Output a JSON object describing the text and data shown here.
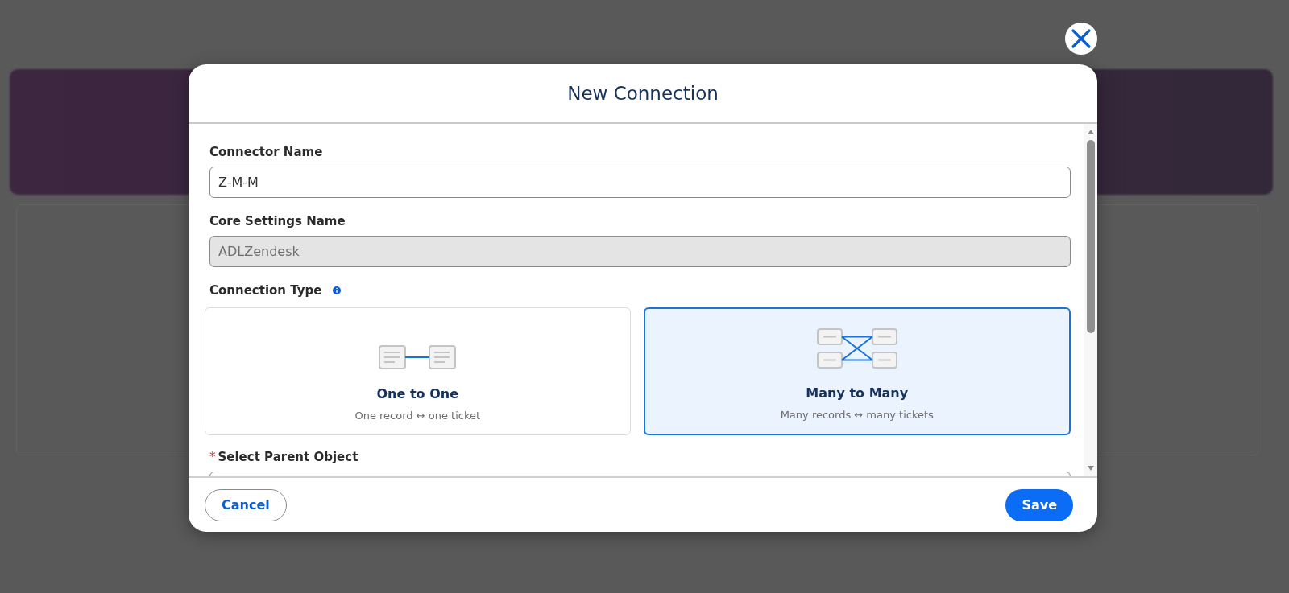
{
  "modal": {
    "title": "New Connection",
    "fields": [
      {
        "label": "Connector Name",
        "value": "Z-M-M",
        "disabled": false
      },
      {
        "label": "Core Settings Name",
        "value": "ADLZendesk",
        "disabled": true
      }
    ],
    "connection_type": {
      "label": "Connection Type",
      "options": [
        {
          "kind": "one",
          "title": "One to One",
          "subtitle": "One record ↔ one ticket",
          "selected": false
        },
        {
          "kind": "many",
          "title": "Many to Many",
          "subtitle": "Many records ↔ many tickets",
          "selected": true
        }
      ]
    },
    "parent_object": {
      "required_mark": "*",
      "label": "Select Parent Object"
    },
    "buttons": [
      {
        "label": "Cancel",
        "kind": "secondary"
      },
      {
        "label": "Save",
        "kind": "primary"
      }
    ]
  }
}
